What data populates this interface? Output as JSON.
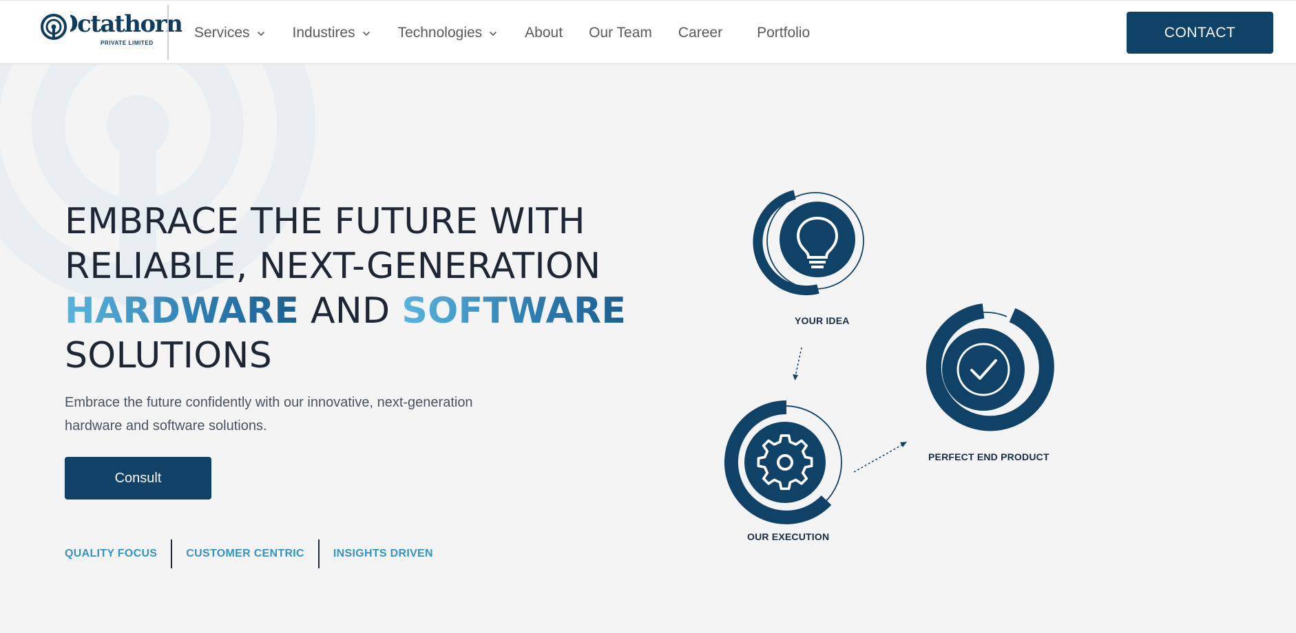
{
  "header": {
    "logo_text": "Octathorn",
    "logo_subtitle": "PRIVATE LIMITED",
    "nav": [
      {
        "label": "Services",
        "has_dropdown": true
      },
      {
        "label": "Industires",
        "has_dropdown": true
      },
      {
        "label": "Technologies",
        "has_dropdown": true
      },
      {
        "label": "About",
        "has_dropdown": false
      },
      {
        "label": "Our Team",
        "has_dropdown": false
      },
      {
        "label": "Career",
        "has_dropdown": false
      },
      {
        "label": "Portfolio",
        "has_dropdown": false
      }
    ],
    "contact_label": "CONTACT"
  },
  "hero": {
    "title_line1": "EMBRACE THE FUTURE WITH",
    "title_line2": "RELIABLE, NEXT-GENERATION",
    "title_accent1": "HARDWARE",
    "title_and": "AND",
    "title_accent2": "SOFTWARE",
    "title_line4": "SOLUTIONS",
    "subtitle": "Embrace the future confidently with our innovative, next-generation hardware and software solutions.",
    "cta_label": "Consult",
    "pillars": [
      "QUALITY FOCUS",
      "CUSTOMER CENTRIC",
      "INSIGHTS DRIVEN"
    ]
  },
  "process": {
    "steps": [
      {
        "label": "YOUR IDEA",
        "icon": "lightbulb-icon"
      },
      {
        "label": "OUR EXECUTION",
        "icon": "gear-icon"
      },
      {
        "label": "PERFECT END PRODUCT",
        "icon": "checkmark-icon"
      }
    ]
  },
  "colors": {
    "primary": "#0f4266",
    "accent": "#3394c4",
    "background": "#f4f4f4",
    "text": "#1e2633"
  }
}
